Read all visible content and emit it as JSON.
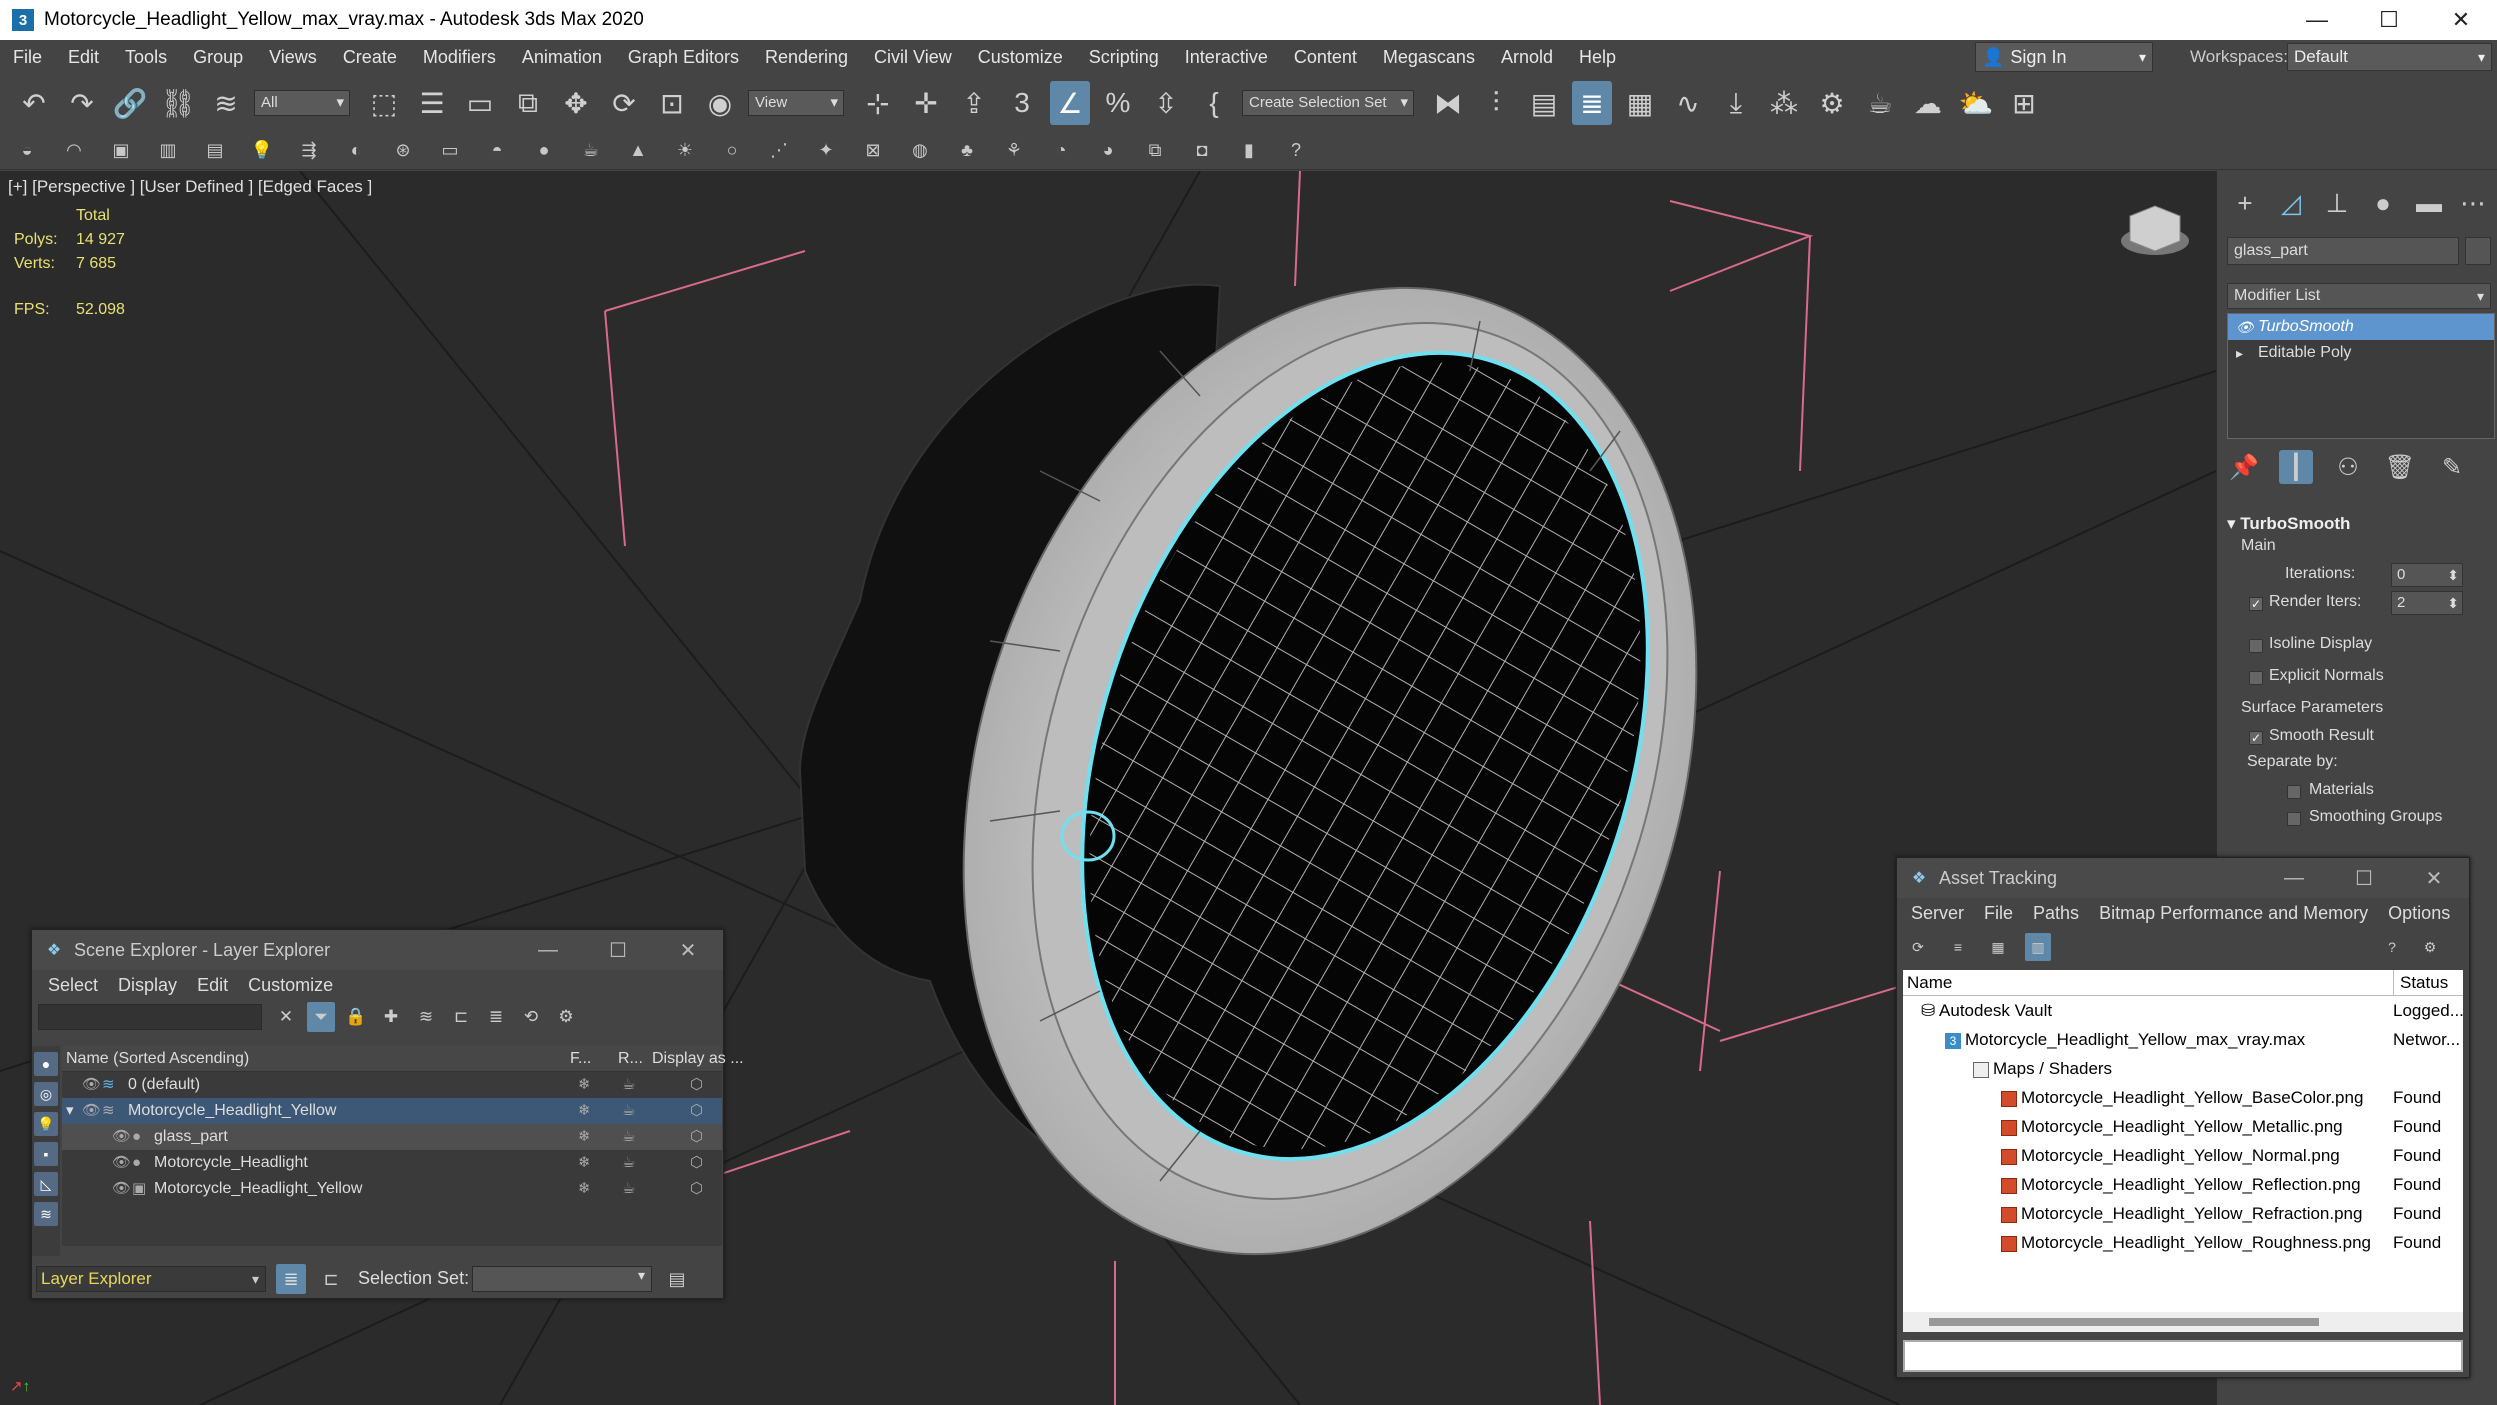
{
  "app": {
    "icon_glyph": "3",
    "title": "Motorcycle_Headlight_Yellow_max_vray.max - Autodesk 3ds Max 2020"
  },
  "menu": [
    "File",
    "Edit",
    "Tools",
    "Group",
    "Views",
    "Create",
    "Modifiers",
    "Animation",
    "Graph Editors",
    "Rendering",
    "Civil View",
    "Customize",
    "Scripting",
    "Interactive",
    "Content",
    "Megascans",
    "Arnold",
    "Help"
  ],
  "account": {
    "sign_in": "Sign In",
    "workspaces_label": "Workspaces:",
    "workspace": "Default"
  },
  "toolbar": {
    "filter": "All",
    "ref_coord": "View",
    "selection_set": "Create Selection Set"
  },
  "viewport": {
    "label": "[+] [Perspective ] [User Defined ] [Edged Faces ]",
    "total_label": "Total",
    "polys_label": "Polys:",
    "polys": "14 927",
    "verts_label": "Verts:",
    "verts": "7 685",
    "fps_label": "FPS:",
    "fps": "52.098"
  },
  "command_panel": {
    "object_name": "glass_part",
    "modifier_list": "Modifier List",
    "stack": [
      "TurboSmooth",
      "Editable Poly"
    ],
    "rollout_title": "TurboSmooth",
    "main": "Main",
    "iterations_label": "Iterations:",
    "iterations": "0",
    "render_iters_label": "Render Iters:",
    "render_iters": "2",
    "isoline": "Isoline Display",
    "explicit_normals": "Explicit Normals",
    "surface_params": "Surface Parameters",
    "smooth_result": "Smooth Result",
    "separate_by": "Separate by:",
    "materials": "Materials",
    "smoothing_groups": "Smoothing Groups"
  },
  "scene_explorer": {
    "title": "Scene Explorer - Layer Explorer",
    "menu": [
      "Select",
      "Display",
      "Edit",
      "Customize"
    ],
    "columns": {
      "name": "Name (Sorted Ascending)",
      "f": "F...",
      "r": "R...",
      "display": "Display as ..."
    },
    "rows": [
      {
        "name": "0 (default)"
      },
      {
        "name": "Motorcycle_Headlight_Yellow"
      },
      {
        "name": "glass_part"
      },
      {
        "name": "Motorcycle_Headlight"
      },
      {
        "name": "Motorcycle_Headlight_Yellow"
      }
    ],
    "footer_explorer": "Layer Explorer",
    "selection_set_label": "Selection Set:"
  },
  "asset_tracking": {
    "title": "Asset Tracking",
    "menu": [
      "Server",
      "File",
      "Paths",
      "Bitmap Performance and Memory",
      "Options"
    ],
    "columns": {
      "name": "Name",
      "status": "Status"
    },
    "rows": [
      {
        "name": "Autodesk Vault",
        "status": "Logged..."
      },
      {
        "name": "Motorcycle_Headlight_Yellow_max_vray.max",
        "status": "Networ..."
      },
      {
        "name": "Maps / Shaders",
        "status": ""
      },
      {
        "name": "Motorcycle_Headlight_Yellow_BaseColor.png",
        "status": "Found"
      },
      {
        "name": "Motorcycle_Headlight_Yellow_Metallic.png",
        "status": "Found"
      },
      {
        "name": "Motorcycle_Headlight_Yellow_Normal.png",
        "status": "Found"
      },
      {
        "name": "Motorcycle_Headlight_Yellow_Reflection.png",
        "status": "Found"
      },
      {
        "name": "Motorcycle_Headlight_Yellow_Refraction.png",
        "status": "Found"
      },
      {
        "name": "Motorcycle_Headlight_Yellow_Roughness.png",
        "status": "Found"
      }
    ]
  },
  "colors": {
    "accent": "#5f88a8",
    "selection": "#5e95cf",
    "stat_text": "#e8e070",
    "viewport_bg": "#2b2b2b"
  }
}
